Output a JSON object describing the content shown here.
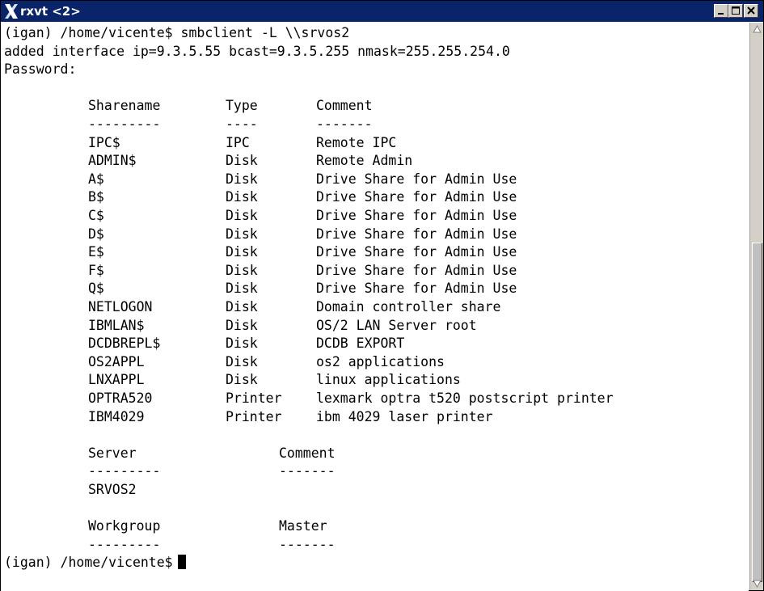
{
  "window": {
    "title": "rxvt <2>",
    "colors": {
      "titlebar": "#0a246a",
      "title_text": "#ffffff",
      "chrome": "#d4d0c8"
    }
  },
  "terminal": {
    "header_lines": [
      "(igan) /home/vicente$ smbclient -L \\\\srvos2",
      "added interface ip=9.3.5.55 bcast=9.3.5.255 nmask=255.255.254.0",
      "Password:"
    ],
    "shares": {
      "headers": [
        "Sharename",
        "Type",
        "Comment"
      ],
      "underlines": [
        "---------",
        "----",
        "-------"
      ],
      "rows": [
        [
          "IPC$",
          "IPC",
          "Remote IPC"
        ],
        [
          "ADMIN$",
          "Disk",
          "Remote Admin"
        ],
        [
          "A$",
          "Disk",
          "Drive Share for Admin Use"
        ],
        [
          "B$",
          "Disk",
          "Drive Share for Admin Use"
        ],
        [
          "C$",
          "Disk",
          "Drive Share for Admin Use"
        ],
        [
          "D$",
          "Disk",
          "Drive Share for Admin Use"
        ],
        [
          "E$",
          "Disk",
          "Drive Share for Admin Use"
        ],
        [
          "F$",
          "Disk",
          "Drive Share for Admin Use"
        ],
        [
          "Q$",
          "Disk",
          "Drive Share for Admin Use"
        ],
        [
          "NETLOGON",
          "Disk",
          "Domain controller share"
        ],
        [
          "IBMLAN$",
          "Disk",
          "OS/2 LAN Server root"
        ],
        [
          "DCDBREPL$",
          "Disk",
          "DCDB EXPORT"
        ],
        [
          "OS2APPL",
          "Disk",
          "os2 applications"
        ],
        [
          "LNXAPPL",
          "Disk",
          "linux applications"
        ],
        [
          "OPTRA520",
          "Printer",
          "lexmark optra t520 postscript printer"
        ],
        [
          "IBM4029",
          "Printer",
          "ibm 4029 laser printer"
        ]
      ]
    },
    "servers": {
      "headers": [
        "Server",
        "Comment"
      ],
      "underlines": [
        "---------",
        "-------"
      ],
      "rows": [
        [
          "SRVOS2",
          ""
        ]
      ]
    },
    "workgroups": {
      "headers": [
        "Workgroup",
        "Master"
      ],
      "underlines": [
        "---------",
        "-------"
      ],
      "rows": []
    },
    "prompt": "(igan) /home/vicente$"
  },
  "icons": {
    "app": "x-window-icon",
    "minimize": "minimize-icon",
    "maximize": "maximize-icon",
    "close": "close-icon",
    "scroll_up": "scroll-up-arrow-icon",
    "scroll_down": "scroll-down-arrow-icon"
  }
}
